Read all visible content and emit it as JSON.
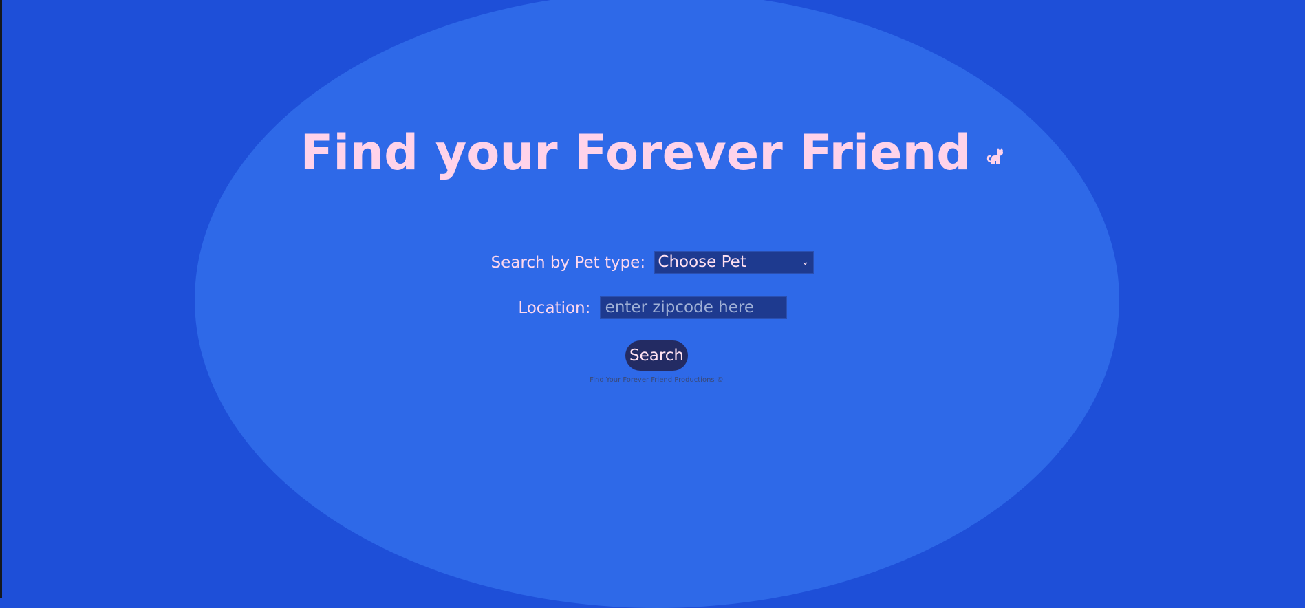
{
  "header": {
    "title": "Find your Forever Friend",
    "icon": "cat-icon"
  },
  "search_form": {
    "pet_type_label": "Search by Pet type:",
    "pet_type_selected": "Choose Pet",
    "location_label": "Location:",
    "location_placeholder": "enter zipcode here",
    "location_value": "",
    "search_button_label": "Search"
  },
  "footer": {
    "text": "Find Your Forever Friend Productions ©"
  },
  "colors": {
    "background": "#1e4fd8",
    "oval": "#2e69e8",
    "title": "#ffd3ea",
    "input_bg": "#1e3a8f",
    "button_bg": "#232b63"
  }
}
